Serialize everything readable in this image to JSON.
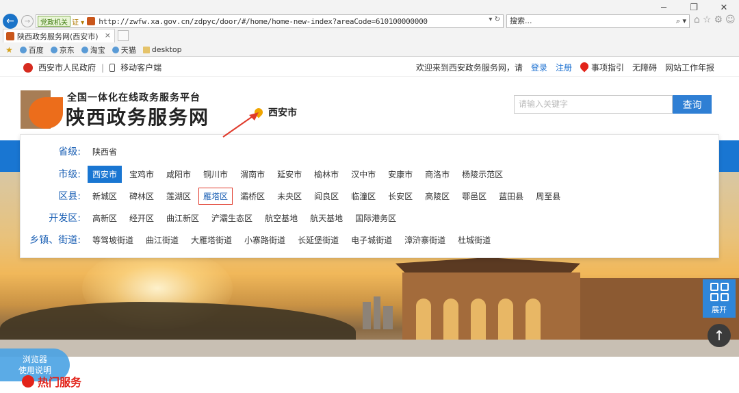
{
  "browser": {
    "gov_tag": "党政机关",
    "cert_tag": "证 ▾",
    "url": "http://zwfw.xa.gov.cn/zdpyc/door/#/home/home-new-index?areaCode=610100000000",
    "addr_tools": "▾ ↻",
    "search_placeholder": "搜索...",
    "tab_title": "陕西政务服务网(西安市)",
    "tab_close": "×",
    "favorites": [
      "百度",
      "京东",
      "淘宝",
      "天猫",
      "desktop"
    ],
    "window_controls": [
      "─",
      "❐",
      "✕"
    ],
    "chrome_icons": [
      "⌂",
      "☆",
      "⚙",
      "☺"
    ]
  },
  "topbar": {
    "gov_name": "西安市人民政府",
    "separator": "|",
    "mobile": "移动客户端",
    "welcome": "欢迎来到西安政务服务网，请",
    "login": "登录",
    "register": "注册",
    "guide": "事项指引",
    "accessibility": "无障碍",
    "annual_report": "网站工作年报"
  },
  "header": {
    "logo_sub": "全国一体化在线政务服务平台",
    "logo_main": "陕西政务服务网",
    "current_city": "西安市",
    "search_placeholder": "请输入关键字",
    "search_button": "查询"
  },
  "region_panel": {
    "rows": [
      {
        "label": "省级:",
        "items": [
          "陕西省"
        ]
      },
      {
        "label": "市级:",
        "items": [
          "西安市",
          "宝鸡市",
          "咸阳市",
          "铜川市",
          "渭南市",
          "延安市",
          "榆林市",
          "汉中市",
          "安康市",
          "商洛市",
          "杨陵示范区"
        ],
        "selected": 0
      },
      {
        "label": "区县:",
        "items": [
          "新城区",
          "碑林区",
          "莲湖区",
          "雁塔区",
          "灞桥区",
          "未央区",
          "阎良区",
          "临潼区",
          "长安区",
          "高陵区",
          "鄠邑区",
          "蓝田县",
          "周至县"
        ],
        "outlined": 3
      },
      {
        "label": "开发区:",
        "items": [
          "高新区",
          "经开区",
          "曲江新区",
          "浐灞生态区",
          "航空基地",
          "航天基地",
          "国际港务区"
        ]
      },
      {
        "label": "乡镇、街道:",
        "items": [
          "等驾坡街道",
          "曲江街道",
          "大雁塔街道",
          "小寨路街道",
          "长延堡街道",
          "电子城街道",
          "漳浒寨街道",
          "杜城街道"
        ]
      }
    ]
  },
  "float": {
    "expand": "展开",
    "totop_icon": "arrow-up-icon"
  },
  "bottom": {
    "browser_help_line1": "浏览器",
    "browser_help_line2": "使用说明",
    "hot_services": "热门服务"
  },
  "colors": {
    "accent": "#1976d2",
    "brand_orange": "#ec6d1b",
    "alert_red": "#e2231a"
  }
}
